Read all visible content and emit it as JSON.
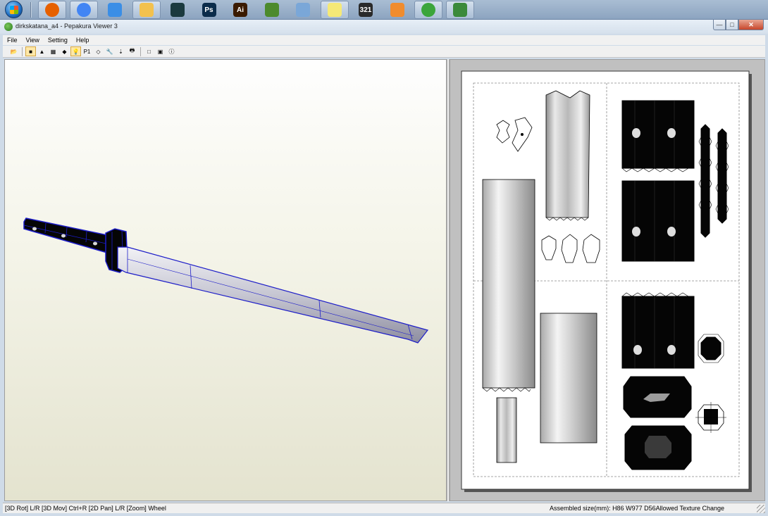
{
  "taskbar": {
    "start_icon": "windows-start-orb",
    "apps": [
      {
        "name": "firefox",
        "icon": "firefox-icon",
        "color": "#e66000",
        "open": true
      },
      {
        "name": "chrome",
        "icon": "chrome-icon",
        "color": "#4285f4",
        "open": true
      },
      {
        "name": "safari",
        "icon": "compass-icon",
        "color": "#3a8ee6",
        "open": false
      },
      {
        "name": "explorer",
        "icon": "folder-icon",
        "color": "#f2c14e",
        "open": true
      },
      {
        "name": "3dsmax",
        "icon": "3dsmax-icon",
        "color": "#1b3a3f",
        "open": false
      },
      {
        "name": "photoshop",
        "icon": "photoshop-icon",
        "color": "#0b2c4b",
        "label": "Ps",
        "open": false
      },
      {
        "name": "illustrator",
        "icon": "illustrator-icon",
        "color": "#3a1a00",
        "label": "Ai",
        "open": false
      },
      {
        "name": "paint-app",
        "icon": "paint-icon",
        "color": "#4c8a2d",
        "open": false
      },
      {
        "name": "paint",
        "icon": "palette-icon",
        "color": "#7aa7d8",
        "open": false
      },
      {
        "name": "sticky-notes",
        "icon": "sticky-notes-icon",
        "color": "#f5e977",
        "open": true
      },
      {
        "name": "media-classic",
        "icon": "media-player-classic-icon",
        "color": "#2a2a2a",
        "label": "321",
        "open": false
      },
      {
        "name": "video-player",
        "icon": "video-player-icon",
        "color": "#f08c2e",
        "open": false
      },
      {
        "name": "utorrent",
        "icon": "utorrent-icon",
        "color": "#3ba53b",
        "open": true
      },
      {
        "name": "pepakura",
        "icon": "pepakura-icon",
        "color": "#3b8a3b",
        "open": true
      }
    ]
  },
  "window": {
    "title": "dirkskatana_a4 - Pepakura Viewer 3",
    "controls": {
      "minimize": "—",
      "maximize": "□",
      "close": "✕"
    }
  },
  "menu": [
    "File",
    "View",
    "Setting",
    "Help"
  ],
  "toolbar": [
    {
      "icon": "open-icon",
      "glyph": "📂"
    },
    {
      "icon": "3d-view-icon",
      "glyph": "■",
      "active": true
    },
    {
      "icon": "2d-view-icon",
      "glyph": "▲"
    },
    {
      "icon": "flaps-icon",
      "glyph": "▦"
    },
    {
      "icon": "texture-icon",
      "glyph": "◆"
    },
    {
      "icon": "light-icon",
      "glyph": "💡",
      "active": true
    },
    {
      "icon": "page-number-icon",
      "glyph": "P1"
    },
    {
      "icon": "fold-lines-icon",
      "glyph": "◇"
    },
    {
      "icon": "settings-icon",
      "glyph": "🔧"
    },
    {
      "icon": "export-icon",
      "glyph": "⇣"
    },
    {
      "icon": "print-icon",
      "glyph": "🖶"
    },
    {
      "icon": "single-pane-icon",
      "glyph": "□"
    },
    {
      "icon": "split-pane-icon",
      "glyph": "▣"
    },
    {
      "icon": "info-icon",
      "glyph": "ⓘ"
    }
  ],
  "colors": {
    "wire": "#1d1dc8",
    "blade_light": "#e6e6ee",
    "blade_dark": "#9c9cac",
    "dark_part": "#050505"
  },
  "status": {
    "left": "[3D Rot] L/R [3D Mov] Ctrl+R [2D Pan] L/R [Zoom] Wheel",
    "right": "Assembled size(mm): H86 W977 D56Allowed Texture Change"
  }
}
